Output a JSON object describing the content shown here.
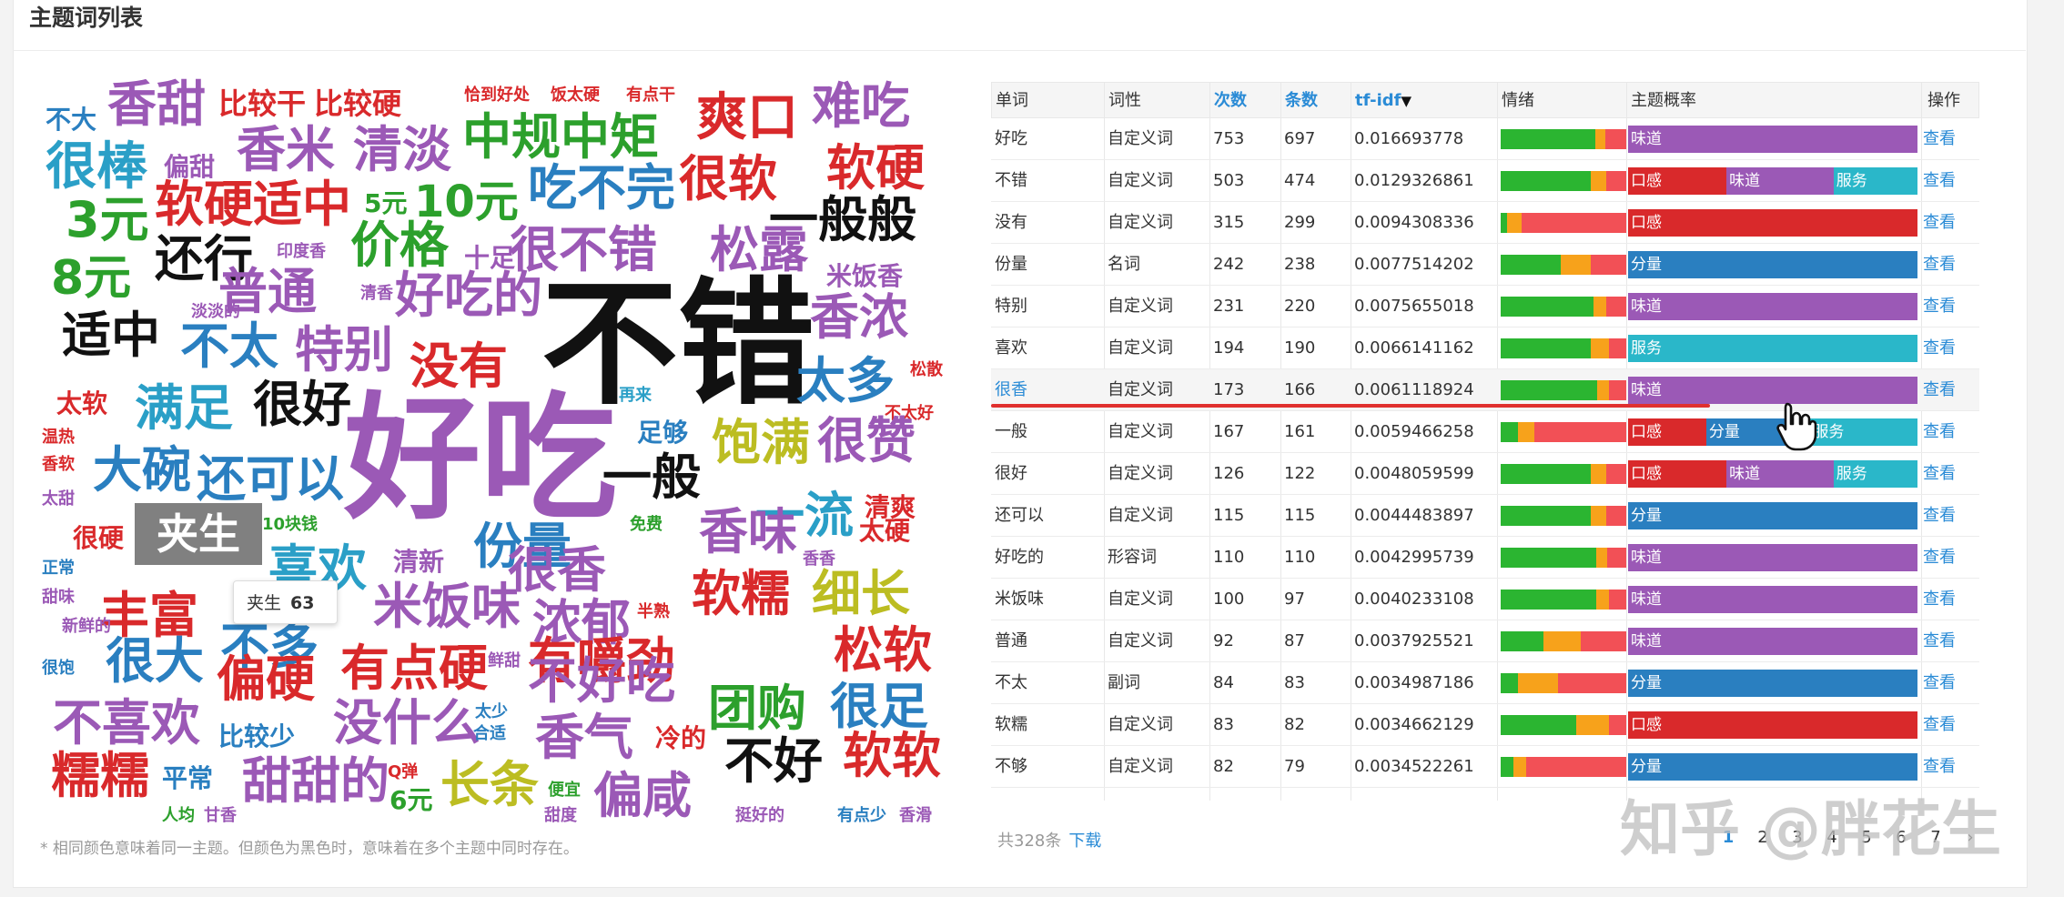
{
  "header": {
    "title": "主题词列表"
  },
  "cloud": {
    "note": "* 相同颜色意味着同一主题。但颜色为黑色时，意味着在多个主题中同时存在。",
    "highlight_word": "夹生",
    "tooltip": {
      "word": "夹生",
      "count": "63"
    },
    "words": [
      {
        "t": "不大",
        "c": "#2a7fc0"
      },
      {
        "t": "香甜",
        "c": "#9b59b6"
      },
      {
        "t": "比较干",
        "c": "#d9292b"
      },
      {
        "t": "比较硬",
        "c": "#d9292b"
      },
      {
        "t": "恰到好处",
        "c": "#d9292b"
      },
      {
        "t": "饭太硬",
        "c": "#d9292b"
      },
      {
        "t": "有点干",
        "c": "#d9292b"
      },
      {
        "t": "爽口",
        "c": "#d9292b"
      },
      {
        "t": "难吃",
        "c": "#9b59b6"
      },
      {
        "t": "很棒",
        "c": "#2a9fc7"
      },
      {
        "t": "偏甜",
        "c": "#9b59b6"
      },
      {
        "t": "香米",
        "c": "#9b59b6"
      },
      {
        "t": "清淡",
        "c": "#9b59b6"
      },
      {
        "t": "中规中矩",
        "c": "#2ca02c"
      },
      {
        "t": "很软",
        "c": "#d9292b"
      },
      {
        "t": "软硬",
        "c": "#d9292b"
      },
      {
        "t": "3元",
        "c": "#2ca02c"
      },
      {
        "t": "软硬适中",
        "c": "#d9292b"
      },
      {
        "t": "5元",
        "c": "#2ca02c"
      },
      {
        "t": "10元",
        "c": "#2ca02c"
      },
      {
        "t": "吃不完",
        "c": "#2a7fc0"
      },
      {
        "t": "一般般",
        "c": "#111111"
      },
      {
        "t": "还行",
        "c": "#111111"
      },
      {
        "t": "印度香",
        "c": "#9b59b6"
      },
      {
        "t": "价格",
        "c": "#2ca02c"
      },
      {
        "t": "十足",
        "c": "#9b59b6"
      },
      {
        "t": "很不错",
        "c": "#9b59b6"
      },
      {
        "t": "松露",
        "c": "#9b59b6"
      },
      {
        "t": "8元",
        "c": "#2ca02c"
      },
      {
        "t": "普通",
        "c": "#9b59b6"
      },
      {
        "t": "清香",
        "c": "#9b59b6"
      },
      {
        "t": "好吃的",
        "c": "#9b59b6"
      },
      {
        "t": "米饭香",
        "c": "#9b59b6"
      },
      {
        "t": "淡淡的",
        "c": "#9b59b6"
      },
      {
        "t": "不错",
        "c": "#111111"
      },
      {
        "t": "香浓",
        "c": "#9b59b6"
      },
      {
        "t": "适中",
        "c": "#111111"
      },
      {
        "t": "不太",
        "c": "#2a7fc0"
      },
      {
        "t": "特别",
        "c": "#9b59b6"
      },
      {
        "t": "没有",
        "c": "#d9292b"
      },
      {
        "t": "太多",
        "c": "#2a7fc0"
      },
      {
        "t": "松散",
        "c": "#d9292b"
      },
      {
        "t": "太软",
        "c": "#d9292b"
      },
      {
        "t": "满足",
        "c": "#2a9fc7"
      },
      {
        "t": "很好",
        "c": "#111111"
      },
      {
        "t": "好吃",
        "c": "#9b59b6"
      },
      {
        "t": "再来",
        "c": "#2a9fc7"
      },
      {
        "t": "不太好",
        "c": "#d9292b"
      },
      {
        "t": "温热",
        "c": "#d9292b"
      },
      {
        "t": "足够",
        "c": "#2a7fc0"
      },
      {
        "t": "饱满",
        "c": "#bcbd22"
      },
      {
        "t": "很赞",
        "c": "#9b59b6"
      },
      {
        "t": "香软",
        "c": "#d9292b"
      },
      {
        "t": "大碗",
        "c": "#2a7fc0"
      },
      {
        "t": "还可以",
        "c": "#2a7fc0"
      },
      {
        "t": "一般",
        "c": "#111111"
      },
      {
        "t": "太甜",
        "c": "#9b59b6"
      },
      {
        "t": "一流",
        "c": "#2a9fc7"
      },
      {
        "t": "清爽",
        "c": "#d9292b"
      },
      {
        "t": "很硬",
        "c": "#d9292b"
      },
      {
        "t": "10块钱",
        "c": "#2ca02c"
      },
      {
        "t": "免费",
        "c": "#2ca02c"
      },
      {
        "t": "香味",
        "c": "#9b59b6"
      },
      {
        "t": "喜欢",
        "c": "#2a9fc7"
      },
      {
        "t": "份量",
        "c": "#2a7fc0"
      },
      {
        "t": "太硬",
        "c": "#d9292b"
      },
      {
        "t": "香香",
        "c": "#9b59b6"
      },
      {
        "t": "正常",
        "c": "#2a7fc0"
      },
      {
        "t": "清新",
        "c": "#9b59b6"
      },
      {
        "t": "很香",
        "c": "#9b59b6"
      },
      {
        "t": "丰富",
        "c": "#d9292b"
      },
      {
        "t": "软糯",
        "c": "#d9292b"
      },
      {
        "t": "细长",
        "c": "#bcbd22"
      },
      {
        "t": "甜味",
        "c": "#9b59b6"
      },
      {
        "t": "米饭味",
        "c": "#9b59b6"
      },
      {
        "t": "浓郁",
        "c": "#9b59b6"
      },
      {
        "t": "半熟",
        "c": "#d9292b"
      },
      {
        "t": "新鲜的",
        "c": "#9b59b6"
      },
      {
        "t": "不多",
        "c": "#2a7fc0"
      },
      {
        "t": "有嚼劲",
        "c": "#d9292b"
      },
      {
        "t": "松软",
        "c": "#d9292b"
      },
      {
        "t": "很大",
        "c": "#2a7fc0"
      },
      {
        "t": "偏硬",
        "c": "#d9292b"
      },
      {
        "t": "有点硬",
        "c": "#d9292b"
      },
      {
        "t": "鲜甜",
        "c": "#9b59b6"
      },
      {
        "t": "很饱",
        "c": "#2a7fc0"
      },
      {
        "t": "不好吃",
        "c": "#9b59b6"
      },
      {
        "t": "团购",
        "c": "#2ca02c"
      },
      {
        "t": "很足",
        "c": "#2a7fc0"
      },
      {
        "t": "不喜欢",
        "c": "#9b59b6"
      },
      {
        "t": "比较少",
        "c": "#2a7fc0"
      },
      {
        "t": "没什么",
        "c": "#9b59b6"
      },
      {
        "t": "太少",
        "c": "#2a7fc0"
      },
      {
        "t": "合适",
        "c": "#2a7fc0"
      },
      {
        "t": "香气",
        "c": "#9b59b6"
      },
      {
        "t": "冷的",
        "c": "#d9292b"
      },
      {
        "t": "不好",
        "c": "#111111"
      },
      {
        "t": "软软",
        "c": "#d9292b"
      },
      {
        "t": "糯糯",
        "c": "#d9292b"
      },
      {
        "t": "平常",
        "c": "#2a7fc0"
      },
      {
        "t": "甜甜的",
        "c": "#9b59b6"
      },
      {
        "t": "Q弹",
        "c": "#d9292b"
      },
      {
        "t": "长条",
        "c": "#bcbd22"
      },
      {
        "t": "便宜",
        "c": "#2ca02c"
      },
      {
        "t": "偏咸",
        "c": "#9b59b6"
      },
      {
        "t": "6元",
        "c": "#2ca02c"
      },
      {
        "t": "甜度",
        "c": "#9b59b6"
      },
      {
        "t": "人均",
        "c": "#2ca02c"
      },
      {
        "t": "甘香",
        "c": "#9b59b6"
      },
      {
        "t": "挺好的",
        "c": "#9b59b6"
      },
      {
        "t": "有点少",
        "c": "#2a7fc0"
      },
      {
        "t": "香滑",
        "c": "#9b59b6"
      }
    ]
  },
  "table": {
    "headers": [
      "单词",
      "词性",
      "次数",
      "条数",
      "tf-idf",
      "情绪",
      "主题概率",
      "操作"
    ],
    "sort_indicator": "▼",
    "rows": [
      {
        "word": "好吃",
        "pos": "自定义词",
        "count": "753",
        "docs": "697",
        "tfidf": "0.016693778",
        "sent": [
          0.75,
          0.08,
          0.17
        ],
        "topics": [
          {
            "label": "味道",
            "w": 1.0,
            "c": "#9b59b6"
          }
        ],
        "op": "查看"
      },
      {
        "word": "不错",
        "pos": "自定义词",
        "count": "503",
        "docs": "474",
        "tfidf": "0.0129326861",
        "sent": [
          0.72,
          0.12,
          0.16
        ],
        "topics": [
          {
            "label": "口感",
            "w": 0.34,
            "c": "#d9292b"
          },
          {
            "label": "味道",
            "w": 0.37,
            "c": "#9b59b6"
          },
          {
            "label": "服务",
            "w": 0.29,
            "c": "#2ab7c9"
          }
        ],
        "op": "查看"
      },
      {
        "word": "没有",
        "pos": "自定义词",
        "count": "315",
        "docs": "299",
        "tfidf": "0.0094308336",
        "sent": [
          0.05,
          0.12,
          0.83
        ],
        "topics": [
          {
            "label": "口感",
            "w": 1.0,
            "c": "#d9292b"
          }
        ],
        "op": "查看"
      },
      {
        "word": "份量",
        "pos": "名词",
        "count": "242",
        "docs": "238",
        "tfidf": "0.0077514202",
        "sent": [
          0.48,
          0.24,
          0.28
        ],
        "topics": [
          {
            "label": "分量",
            "w": 1.0,
            "c": "#2a7fc0"
          }
        ],
        "op": "查看"
      },
      {
        "word": "特别",
        "pos": "自定义词",
        "count": "231",
        "docs": "220",
        "tfidf": "0.0075655018",
        "sent": [
          0.74,
          0.1,
          0.16
        ],
        "topics": [
          {
            "label": "味道",
            "w": 1.0,
            "c": "#9b59b6"
          }
        ],
        "op": "查看"
      },
      {
        "word": "喜欢",
        "pos": "自定义词",
        "count": "194",
        "docs": "190",
        "tfidf": "0.0066141162",
        "sent": [
          0.72,
          0.14,
          0.14
        ],
        "topics": [
          {
            "label": "服务",
            "w": 1.0,
            "c": "#2ab7c9"
          }
        ],
        "op": "查看"
      },
      {
        "word": "很香",
        "pos": "自定义词",
        "count": "173",
        "docs": "166",
        "tfidf": "0.0061118924",
        "sent": [
          0.77,
          0.09,
          0.14
        ],
        "topics": [
          {
            "label": "味道",
            "w": 1.0,
            "c": "#9b59b6"
          }
        ],
        "op": "查看",
        "highlight": true
      },
      {
        "word": "一般",
        "pos": "自定义词",
        "count": "167",
        "docs": "161",
        "tfidf": "0.0059466258",
        "sent": [
          0.14,
          0.13,
          0.73
        ],
        "topics": [
          {
            "label": "口感",
            "w": 0.27,
            "c": "#d9292b"
          },
          {
            "label": "分量",
            "w": 0.36,
            "c": "#2a7fc0"
          },
          {
            "label": "服务",
            "w": 0.37,
            "c": "#2ab7c9"
          }
        ],
        "op": "查看"
      },
      {
        "word": "很好",
        "pos": "自定义词",
        "count": "126",
        "docs": "122",
        "tfidf": "0.0048059599",
        "sent": [
          0.72,
          0.12,
          0.16
        ],
        "topics": [
          {
            "label": "口感",
            "w": 0.34,
            "c": "#d9292b"
          },
          {
            "label": "味道",
            "w": 0.37,
            "c": "#9b59b6"
          },
          {
            "label": "服务",
            "w": 0.29,
            "c": "#2ab7c9"
          }
        ],
        "op": "查看"
      },
      {
        "word": "还可以",
        "pos": "自定义词",
        "count": "115",
        "docs": "115",
        "tfidf": "0.0044483897",
        "sent": [
          0.72,
          0.12,
          0.16
        ],
        "topics": [
          {
            "label": "分量",
            "w": 1.0,
            "c": "#2a7fc0"
          }
        ],
        "op": "查看"
      },
      {
        "word": "好吃的",
        "pos": "形容词",
        "count": "110",
        "docs": "110",
        "tfidf": "0.0042995739",
        "sent": [
          0.76,
          0.09,
          0.15
        ],
        "topics": [
          {
            "label": "味道",
            "w": 1.0,
            "c": "#9b59b6"
          }
        ],
        "op": "查看"
      },
      {
        "word": "米饭味",
        "pos": "自定义词",
        "count": "100",
        "docs": "97",
        "tfidf": "0.0040233108",
        "sent": [
          0.76,
          0.1,
          0.14
        ],
        "topics": [
          {
            "label": "味道",
            "w": 1.0,
            "c": "#9b59b6"
          }
        ],
        "op": "查看"
      },
      {
        "word": "普通",
        "pos": "自定义词",
        "count": "92",
        "docs": "87",
        "tfidf": "0.0037925521",
        "sent": [
          0.34,
          0.3,
          0.36
        ],
        "topics": [
          {
            "label": "味道",
            "w": 1.0,
            "c": "#9b59b6"
          }
        ],
        "op": "查看"
      },
      {
        "word": "不太",
        "pos": "副词",
        "count": "84",
        "docs": "83",
        "tfidf": "0.0034987186",
        "sent": [
          0.14,
          0.32,
          0.54
        ],
        "topics": [
          {
            "label": "分量",
            "w": 1.0,
            "c": "#2a7fc0"
          }
        ],
        "op": "查看"
      },
      {
        "word": "软糯",
        "pos": "自定义词",
        "count": "83",
        "docs": "82",
        "tfidf": "0.0034662129",
        "sent": [
          0.6,
          0.26,
          0.14
        ],
        "topics": [
          {
            "label": "口感",
            "w": 1.0,
            "c": "#d9292b"
          }
        ],
        "op": "查看"
      },
      {
        "word": "不够",
        "pos": "自定义词",
        "count": "82",
        "docs": "79",
        "tfidf": "0.0034522261",
        "sent": [
          0.1,
          0.1,
          0.8
        ],
        "topics": [
          {
            "label": "分量",
            "w": 1.0,
            "c": "#2a7fc0"
          }
        ],
        "op": "查看"
      }
    ],
    "sentiment_colors": [
      "#2bb531",
      "#f7a21b",
      "#f25056"
    ]
  },
  "footer": {
    "total": "共328条",
    "download": "下载",
    "pages": [
      "1",
      "2",
      "3",
      "4",
      "5",
      "6",
      "7",
      "›"
    ],
    "current_page": "1"
  },
  "watermark": "知乎 @胖花生"
}
